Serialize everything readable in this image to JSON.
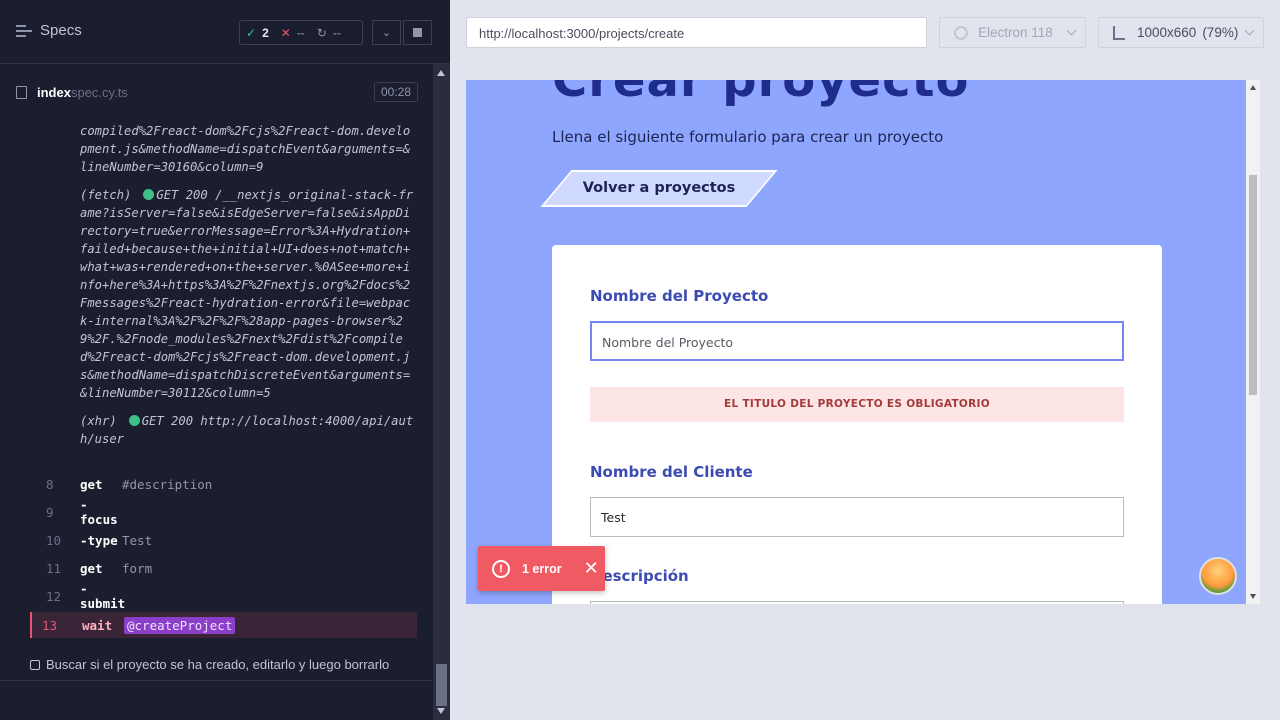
{
  "runner": {
    "specs_label": "Specs",
    "stats": {
      "passed": "2",
      "failed": "--",
      "pending": "--"
    },
    "spec": {
      "name": "index",
      "ext": "spec.cy.ts",
      "time": "00:28"
    },
    "log_entries": [
      {
        "text": "compiled%2Freact-dom%2Fcjs%2Freact-dom.development.js&methodName=dispatchEvent&arguments=&lineNumber=30160&column=9"
      },
      {
        "prefix": "(fetch)",
        "status": "GET 200",
        "text": "/__nextjs_original-stack-frame?isServer=false&isEdgeServer=false&isAppDirectory=true&errorMessage=Error%3A+Hydration+failed+because+the+initial+UI+does+not+match+what+was+rendered+on+the+server.%0ASee+more+info+here%3A+https%3A%2F%2Fnextjs.org%2Fdocs%2Fmessages%2Freact-hydration-error&file=webpack-internal%3A%2F%2F%2F%28app-pages-browser%29%2F.%2Fnode_modules%2Fnext%2Fdist%2Fcompiled%2Freact-dom%2Fcjs%2Freact-dom.development.js&methodName=dispatchDiscreteEvent&arguments=&lineNumber=30112&column=5"
      },
      {
        "prefix": "(xhr)",
        "status": "GET 200",
        "text": "http://localhost:4000/api/auth/user"
      }
    ],
    "commands": [
      {
        "num": "8",
        "name": "get",
        "arg": "#description"
      },
      {
        "num": "9",
        "name": "-focus",
        "arg": ""
      },
      {
        "num": "10",
        "name": "-type",
        "arg": "Test"
      },
      {
        "num": "11",
        "name": "get",
        "arg": "form"
      },
      {
        "num": "12",
        "name": "-submit",
        "arg": ""
      },
      {
        "num": "13",
        "name": "wait",
        "arg": "@createProject"
      }
    ],
    "test_title": "Buscar si el proyecto se ha creado, editarlo y luego borrarlo"
  },
  "browser": {
    "url": "http://localhost:3000/projects/create",
    "engine": "Electron 118",
    "viewport": "1000x660",
    "scale": "(79%)"
  },
  "app": {
    "title": "Crear proyecto",
    "subtitle": "Llena el siguiente formulario para crear un proyecto",
    "back_button": "Volver a proyectos",
    "fields": {
      "project_label": "Nombre del Proyecto",
      "project_placeholder": "Nombre del Proyecto",
      "project_error": "EL TITULO DEL PROYECTO ES OBLIGATORIO",
      "client_label": "Nombre del Cliente",
      "client_value": "Test",
      "description_label": "Descripción"
    }
  },
  "toast": {
    "label": "1 error"
  }
}
